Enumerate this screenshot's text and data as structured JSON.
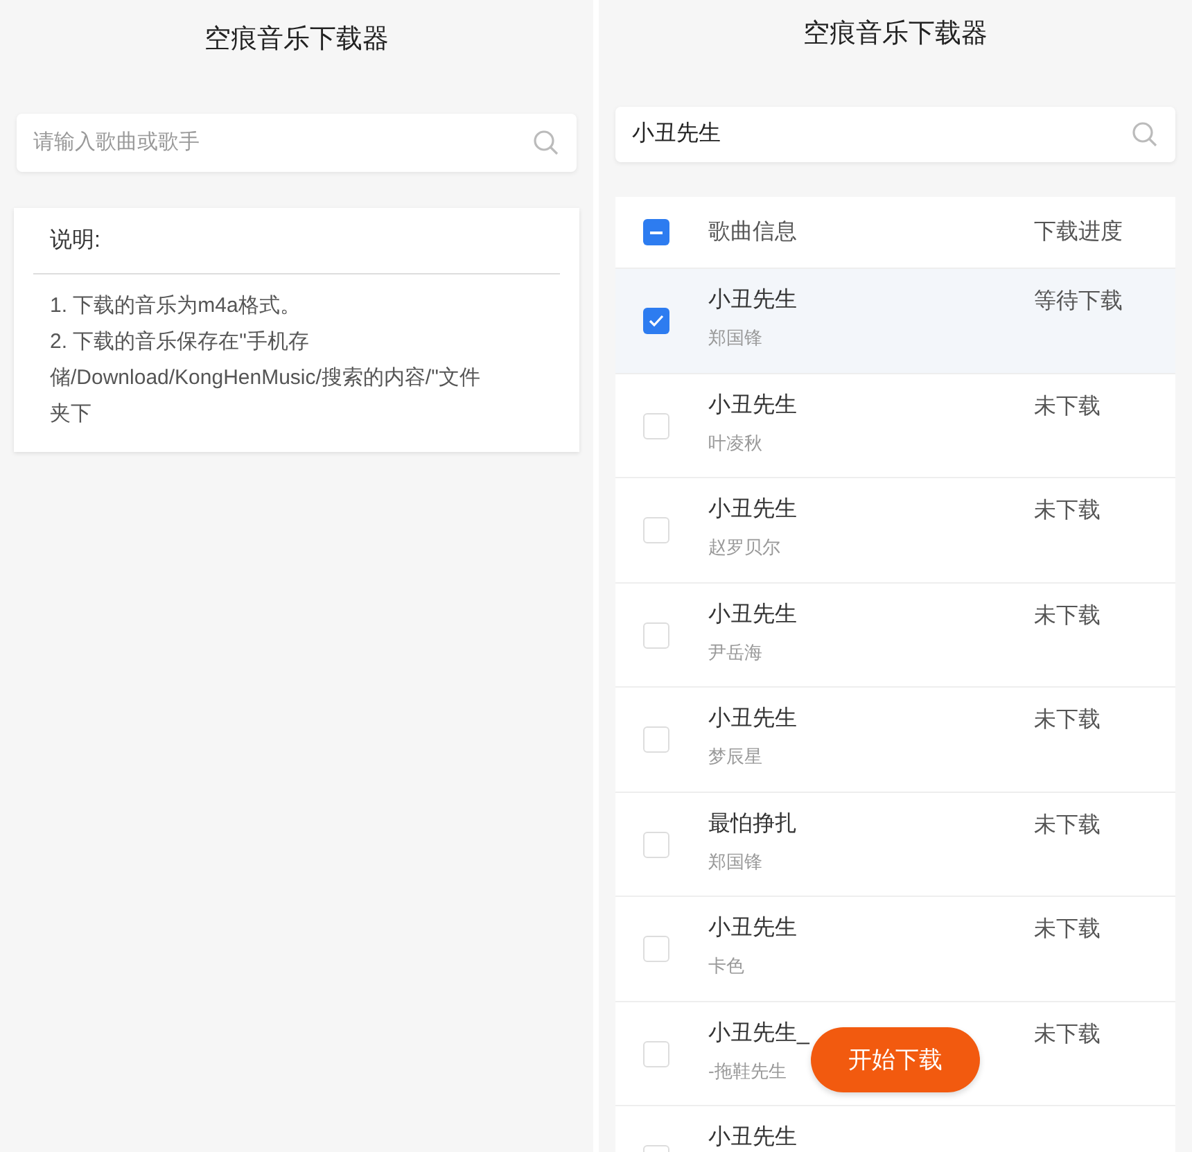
{
  "left": {
    "title": "空痕音乐下载器",
    "search": {
      "placeholder": "请输入歌曲或歌手"
    },
    "notes": {
      "heading": "说明:",
      "lines": [
        "1. 下载的音乐为m4a格式。",
        "2. 下载的音乐保存在\"手机存储/Download/KongHenMusic/搜索的内容/\"文件夹下"
      ]
    }
  },
  "right": {
    "title": "空痕音乐下载器",
    "search": {
      "value": "小丑先生"
    },
    "table": {
      "header": {
        "select_all": {
          "checked": true,
          "indeterminate": true
        },
        "columns": [
          "歌曲信息",
          "下载进度"
        ]
      },
      "rows": [
        {
          "title": "小丑先生",
          "artist": "郑国锋",
          "progress": "等待下载",
          "selected": true
        },
        {
          "title": "小丑先生",
          "artist": "叶凌秋",
          "progress": "未下载",
          "selected": false
        },
        {
          "title": "小丑先生",
          "artist": "赵罗贝尔",
          "progress": "未下载",
          "selected": false
        },
        {
          "title": "小丑先生",
          "artist": "尹岳海",
          "progress": "未下载",
          "selected": false
        },
        {
          "title": "小丑先生",
          "artist": "梦辰星",
          "progress": "未下载",
          "selected": false
        },
        {
          "title": "最怕挣扎",
          "artist": "郑国锋",
          "progress": "未下载",
          "selected": false
        },
        {
          "title": "小丑先生",
          "artist": "卡色",
          "progress": "未下载",
          "selected": false
        },
        {
          "title": "小丑先生_",
          "artist": "-拖鞋先生",
          "progress": "未下载",
          "selected": false
        },
        {
          "title": "小丑先生",
          "selected": false
        }
      ]
    },
    "start_button": "开始下载"
  }
}
